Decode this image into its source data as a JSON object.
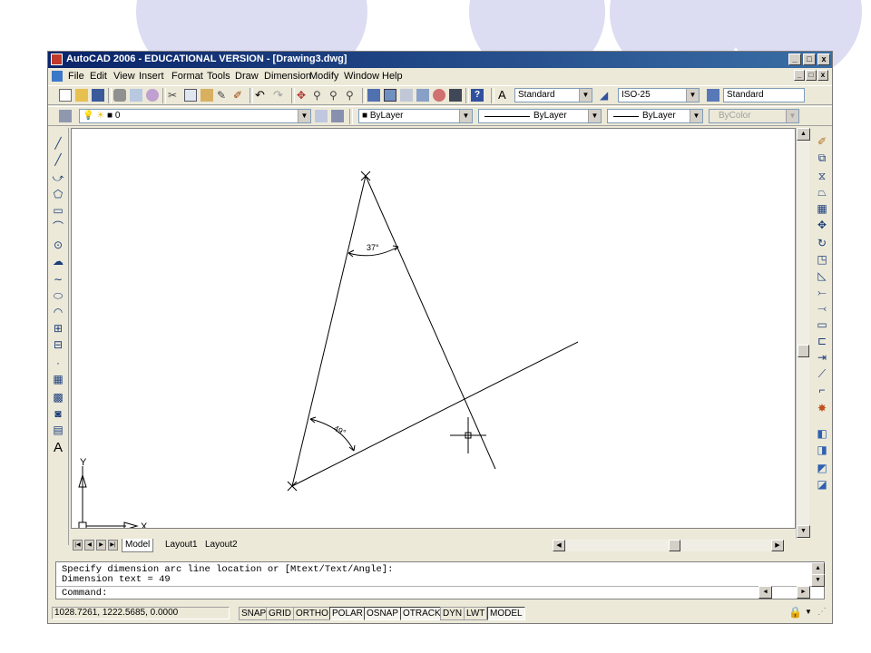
{
  "window": {
    "title": "AutoCAD 2006 - EDUCATIONAL VERSION - [Drawing3.dwg]",
    "min_glyph": "_",
    "max_glyph": "□",
    "close_glyph": "x"
  },
  "menu": [
    "File",
    "Edit",
    "View",
    "Insert",
    "Format",
    "Tools",
    "Draw",
    "Dimension",
    "Modify",
    "Window",
    "Help"
  ],
  "toolbar": {
    "text_style": "Standard",
    "dim_style": "ISO-25",
    "table_style": "Standard",
    "layer": "0",
    "color": "ByLayer",
    "linetype": "ByLayer",
    "lineweight": "ByLayer",
    "plotstyle": "ByColor"
  },
  "drawing": {
    "angle_top": "37°",
    "angle_bottom": "49°",
    "ucs_x": "X",
    "ucs_y": "Y"
  },
  "tabs": [
    "Model",
    "Layout1",
    "Layout2"
  ],
  "command": {
    "line1": "Specify dimension arc line location or [Mtext/Text/Angle]:",
    "line2": "Dimension text = 49",
    "prompt": "Command:"
  },
  "status": {
    "coords": "1028.7261, 1222.5685, 0.0000",
    "buttons": [
      "SNAP",
      "GRID",
      "ORTHO",
      "POLAR",
      "OSNAP",
      "OTRACK",
      "DYN",
      "LWT",
      "MODEL"
    ]
  },
  "colors": {
    "title_bar": "#0a246a",
    "background_decor": "#dcdcf2"
  }
}
